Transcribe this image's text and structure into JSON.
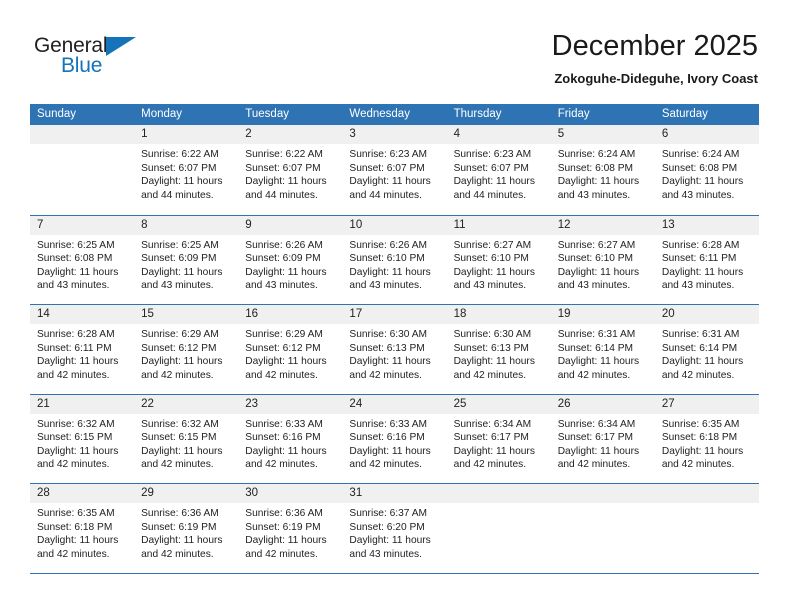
{
  "logo": {
    "text_primary": "General",
    "text_secondary": "Blue",
    "triangle_icon": "triangle-icon",
    "color_primary": "#231f20",
    "color_secondary": "#1573b9"
  },
  "header": {
    "title": "December 2025",
    "subtitle": "Zokoguhe-Dideguhe, Ivory Coast"
  },
  "colors": {
    "header_row_bg": "#2e74b5",
    "header_row_text": "#ffffff",
    "day_band_bg": "#f0f0f0",
    "week_separator": "#2e74b5",
    "body_text": "#222222"
  },
  "weekday_headers": [
    "Sunday",
    "Monday",
    "Tuesday",
    "Wednesday",
    "Thursday",
    "Friday",
    "Saturday"
  ],
  "weeks": [
    [
      {
        "day": "",
        "sunrise": "",
        "sunset": "",
        "daylight_line1": "",
        "daylight_line2": "",
        "empty": true
      },
      {
        "day": "1",
        "sunrise": "Sunrise: 6:22 AM",
        "sunset": "Sunset: 6:07 PM",
        "daylight_line1": "Daylight: 11 hours",
        "daylight_line2": "and 44 minutes.",
        "empty": false
      },
      {
        "day": "2",
        "sunrise": "Sunrise: 6:22 AM",
        "sunset": "Sunset: 6:07 PM",
        "daylight_line1": "Daylight: 11 hours",
        "daylight_line2": "and 44 minutes.",
        "empty": false
      },
      {
        "day": "3",
        "sunrise": "Sunrise: 6:23 AM",
        "sunset": "Sunset: 6:07 PM",
        "daylight_line1": "Daylight: 11 hours",
        "daylight_line2": "and 44 minutes.",
        "empty": false
      },
      {
        "day": "4",
        "sunrise": "Sunrise: 6:23 AM",
        "sunset": "Sunset: 6:07 PM",
        "daylight_line1": "Daylight: 11 hours",
        "daylight_line2": "and 44 minutes.",
        "empty": false
      },
      {
        "day": "5",
        "sunrise": "Sunrise: 6:24 AM",
        "sunset": "Sunset: 6:08 PM",
        "daylight_line1": "Daylight: 11 hours",
        "daylight_line2": "and 43 minutes.",
        "empty": false
      },
      {
        "day": "6",
        "sunrise": "Sunrise: 6:24 AM",
        "sunset": "Sunset: 6:08 PM",
        "daylight_line1": "Daylight: 11 hours",
        "daylight_line2": "and 43 minutes.",
        "empty": false
      }
    ],
    [
      {
        "day": "7",
        "sunrise": "Sunrise: 6:25 AM",
        "sunset": "Sunset: 6:08 PM",
        "daylight_line1": "Daylight: 11 hours",
        "daylight_line2": "and 43 minutes.",
        "empty": false
      },
      {
        "day": "8",
        "sunrise": "Sunrise: 6:25 AM",
        "sunset": "Sunset: 6:09 PM",
        "daylight_line1": "Daylight: 11 hours",
        "daylight_line2": "and 43 minutes.",
        "empty": false
      },
      {
        "day": "9",
        "sunrise": "Sunrise: 6:26 AM",
        "sunset": "Sunset: 6:09 PM",
        "daylight_line1": "Daylight: 11 hours",
        "daylight_line2": "and 43 minutes.",
        "empty": false
      },
      {
        "day": "10",
        "sunrise": "Sunrise: 6:26 AM",
        "sunset": "Sunset: 6:10 PM",
        "daylight_line1": "Daylight: 11 hours",
        "daylight_line2": "and 43 minutes.",
        "empty": false
      },
      {
        "day": "11",
        "sunrise": "Sunrise: 6:27 AM",
        "sunset": "Sunset: 6:10 PM",
        "daylight_line1": "Daylight: 11 hours",
        "daylight_line2": "and 43 minutes.",
        "empty": false
      },
      {
        "day": "12",
        "sunrise": "Sunrise: 6:27 AM",
        "sunset": "Sunset: 6:10 PM",
        "daylight_line1": "Daylight: 11 hours",
        "daylight_line2": "and 43 minutes.",
        "empty": false
      },
      {
        "day": "13",
        "sunrise": "Sunrise: 6:28 AM",
        "sunset": "Sunset: 6:11 PM",
        "daylight_line1": "Daylight: 11 hours",
        "daylight_line2": "and 43 minutes.",
        "empty": false
      }
    ],
    [
      {
        "day": "14",
        "sunrise": "Sunrise: 6:28 AM",
        "sunset": "Sunset: 6:11 PM",
        "daylight_line1": "Daylight: 11 hours",
        "daylight_line2": "and 42 minutes.",
        "empty": false
      },
      {
        "day": "15",
        "sunrise": "Sunrise: 6:29 AM",
        "sunset": "Sunset: 6:12 PM",
        "daylight_line1": "Daylight: 11 hours",
        "daylight_line2": "and 42 minutes.",
        "empty": false
      },
      {
        "day": "16",
        "sunrise": "Sunrise: 6:29 AM",
        "sunset": "Sunset: 6:12 PM",
        "daylight_line1": "Daylight: 11 hours",
        "daylight_line2": "and 42 minutes.",
        "empty": false
      },
      {
        "day": "17",
        "sunrise": "Sunrise: 6:30 AM",
        "sunset": "Sunset: 6:13 PM",
        "daylight_line1": "Daylight: 11 hours",
        "daylight_line2": "and 42 minutes.",
        "empty": false
      },
      {
        "day": "18",
        "sunrise": "Sunrise: 6:30 AM",
        "sunset": "Sunset: 6:13 PM",
        "daylight_line1": "Daylight: 11 hours",
        "daylight_line2": "and 42 minutes.",
        "empty": false
      },
      {
        "day": "19",
        "sunrise": "Sunrise: 6:31 AM",
        "sunset": "Sunset: 6:14 PM",
        "daylight_line1": "Daylight: 11 hours",
        "daylight_line2": "and 42 minutes.",
        "empty": false
      },
      {
        "day": "20",
        "sunrise": "Sunrise: 6:31 AM",
        "sunset": "Sunset: 6:14 PM",
        "daylight_line1": "Daylight: 11 hours",
        "daylight_line2": "and 42 minutes.",
        "empty": false
      }
    ],
    [
      {
        "day": "21",
        "sunrise": "Sunrise: 6:32 AM",
        "sunset": "Sunset: 6:15 PM",
        "daylight_line1": "Daylight: 11 hours",
        "daylight_line2": "and 42 minutes.",
        "empty": false
      },
      {
        "day": "22",
        "sunrise": "Sunrise: 6:32 AM",
        "sunset": "Sunset: 6:15 PM",
        "daylight_line1": "Daylight: 11 hours",
        "daylight_line2": "and 42 minutes.",
        "empty": false
      },
      {
        "day": "23",
        "sunrise": "Sunrise: 6:33 AM",
        "sunset": "Sunset: 6:16 PM",
        "daylight_line1": "Daylight: 11 hours",
        "daylight_line2": "and 42 minutes.",
        "empty": false
      },
      {
        "day": "24",
        "sunrise": "Sunrise: 6:33 AM",
        "sunset": "Sunset: 6:16 PM",
        "daylight_line1": "Daylight: 11 hours",
        "daylight_line2": "and 42 minutes.",
        "empty": false
      },
      {
        "day": "25",
        "sunrise": "Sunrise: 6:34 AM",
        "sunset": "Sunset: 6:17 PM",
        "daylight_line1": "Daylight: 11 hours",
        "daylight_line2": "and 42 minutes.",
        "empty": false
      },
      {
        "day": "26",
        "sunrise": "Sunrise: 6:34 AM",
        "sunset": "Sunset: 6:17 PM",
        "daylight_line1": "Daylight: 11 hours",
        "daylight_line2": "and 42 minutes.",
        "empty": false
      },
      {
        "day": "27",
        "sunrise": "Sunrise: 6:35 AM",
        "sunset": "Sunset: 6:18 PM",
        "daylight_line1": "Daylight: 11 hours",
        "daylight_line2": "and 42 minutes.",
        "empty": false
      }
    ],
    [
      {
        "day": "28",
        "sunrise": "Sunrise: 6:35 AM",
        "sunset": "Sunset: 6:18 PM",
        "daylight_line1": "Daylight: 11 hours",
        "daylight_line2": "and 42 minutes.",
        "empty": false
      },
      {
        "day": "29",
        "sunrise": "Sunrise: 6:36 AM",
        "sunset": "Sunset: 6:19 PM",
        "daylight_line1": "Daylight: 11 hours",
        "daylight_line2": "and 42 minutes.",
        "empty": false
      },
      {
        "day": "30",
        "sunrise": "Sunrise: 6:36 AM",
        "sunset": "Sunset: 6:19 PM",
        "daylight_line1": "Daylight: 11 hours",
        "daylight_line2": "and 42 minutes.",
        "empty": false
      },
      {
        "day": "31",
        "sunrise": "Sunrise: 6:37 AM",
        "sunset": "Sunset: 6:20 PM",
        "daylight_line1": "Daylight: 11 hours",
        "daylight_line2": "and 43 minutes.",
        "empty": false
      },
      {
        "day": "",
        "sunrise": "",
        "sunset": "",
        "daylight_line1": "",
        "daylight_line2": "",
        "empty": true
      },
      {
        "day": "",
        "sunrise": "",
        "sunset": "",
        "daylight_line1": "",
        "daylight_line2": "",
        "empty": true
      },
      {
        "day": "",
        "sunrise": "",
        "sunset": "",
        "daylight_line1": "",
        "daylight_line2": "",
        "empty": true
      }
    ]
  ]
}
